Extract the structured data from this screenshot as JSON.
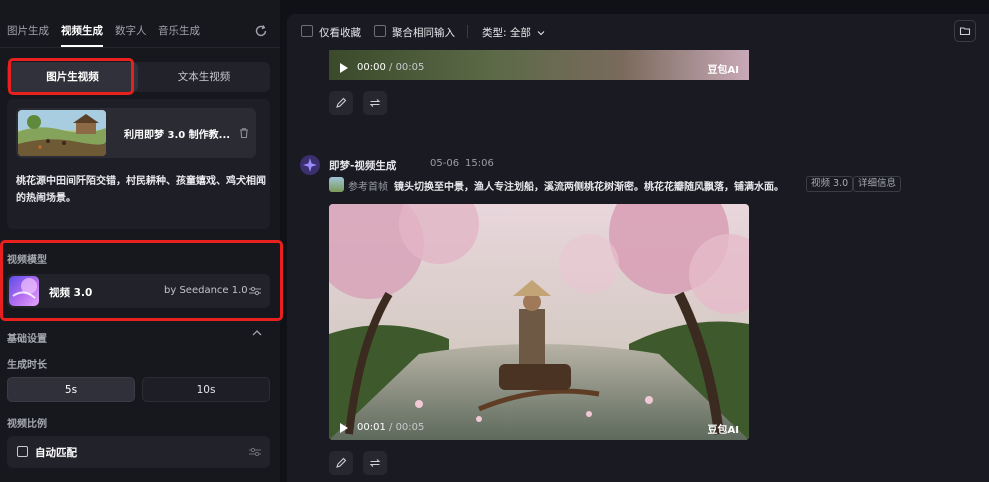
{
  "tabs": [
    "图片生成",
    "视频生成",
    "数字人",
    "音乐生成"
  ],
  "mode": {
    "image_to_video": "图片生视频",
    "text_to_video": "文本生视频"
  },
  "ref_card": {
    "title": "利用即梦 3.0 制作教..."
  },
  "prompt": "桃花源中田间阡陌交错，村民耕种、孩童嬉戏、鸡犬相闻的热闹场景。",
  "model_section": {
    "label": "视频模型",
    "model_name": "视频 3.0",
    "model_by": "by Seedance 1.0"
  },
  "basic_settings": {
    "label": "基础设置"
  },
  "duration": {
    "label": "生成时长",
    "options": [
      "5s",
      "10s"
    ],
    "selected": "5s"
  },
  "ratio": {
    "label": "视频比例",
    "value": "自动匹配"
  },
  "toolbar": {
    "fav_only": "仅看收藏",
    "merge_same": "聚合相同输入",
    "type_filter": "类型: 全部"
  },
  "feed": {
    "video1": {
      "time_current": "00:00",
      "time_total": "/ 00:05",
      "watermark": "豆包AI"
    },
    "entry": {
      "author": "即梦-视频生成",
      "date": "05-06",
      "time": "15:06",
      "ref_label": "参考首帧",
      "prompt": "镜头切换至中景，渔人专注划船，溪流两侧桃花树渐密。桃花花瓣随风飘落，铺满水面。",
      "tag_model": "视频 3.0",
      "tag_detail": "详细信息"
    },
    "video2": {
      "time_current": "00:01",
      "time_total": "/ 00:05",
      "watermark": "豆包AI"
    }
  },
  "colors": {
    "highlight": "#e8201e",
    "panel": "#17181e",
    "feed_bg": "#1a1b22"
  }
}
